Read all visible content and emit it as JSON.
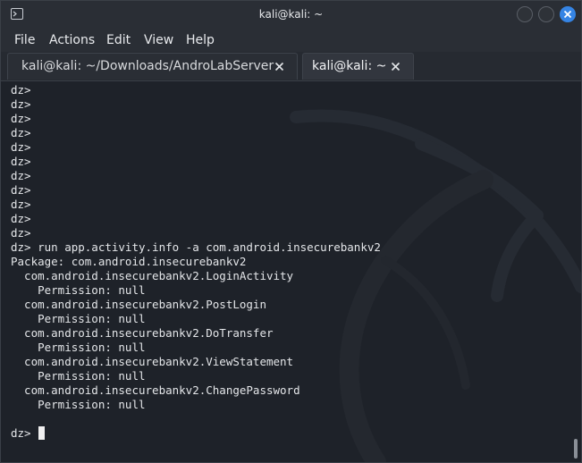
{
  "window": {
    "title": "kali@kali: ~",
    "colors": {
      "close_button": "#3584e4",
      "background": "#1e2229"
    }
  },
  "menu": {
    "items": [
      "File",
      "Actions",
      "Edit",
      "View",
      "Help"
    ]
  },
  "tabs": [
    {
      "label": "kali@kali: ~/Downloads/AndroLabServer",
      "active": false
    },
    {
      "label": "kali@kali: ~",
      "active": true
    }
  ],
  "terminal": {
    "lines": [
      "dz>",
      "dz>",
      "dz>",
      "dz>",
      "dz>",
      "dz>",
      "dz>",
      "dz>",
      "dz>",
      "dz>",
      "dz>",
      "dz> run app.activity.info -a com.android.insecurebankv2",
      "Package: com.android.insecurebankv2",
      "  com.android.insecurebankv2.LoginActivity",
      "    Permission: null",
      "  com.android.insecurebankv2.PostLogin",
      "    Permission: null",
      "  com.android.insecurebankv2.DoTransfer",
      "    Permission: null",
      "  com.android.insecurebankv2.ViewStatement",
      "    Permission: null",
      "  com.android.insecurebankv2.ChangePassword",
      "    Permission: null"
    ],
    "prompt": "dz> "
  },
  "icons": {
    "app": "terminal-icon",
    "minimize": "minimize-icon",
    "maximize": "maximize-icon",
    "close": "close-icon",
    "tab_close": "close-icon"
  }
}
